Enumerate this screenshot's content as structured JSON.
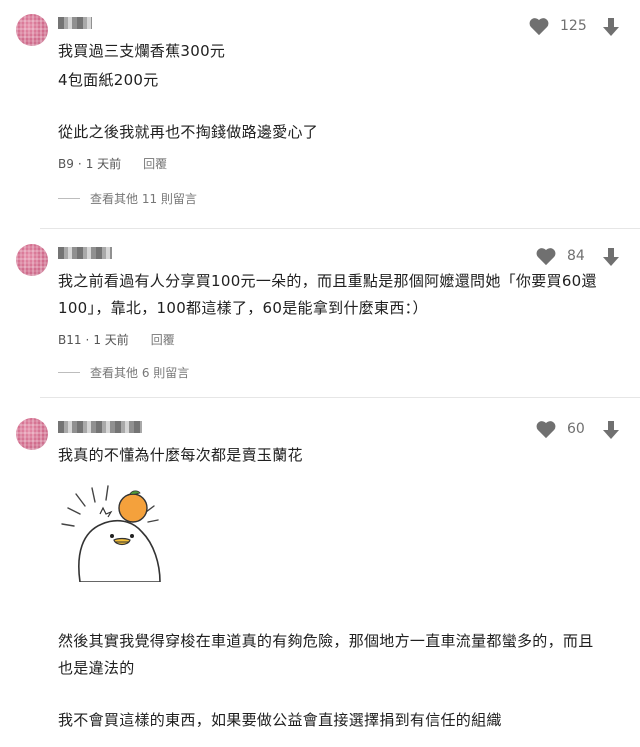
{
  "comments": [
    {
      "likes": "125",
      "lines": [
        "我買過三支爛香蕉300元",
        "4包面紙200元",
        "",
        "從此之後我就再也不掏錢做路邊愛心了"
      ],
      "floor": "B9",
      "time": "1 天前",
      "reply_label": "回覆",
      "view_more": "查看其他 11 則留言"
    },
    {
      "likes": "84",
      "lines": [
        "我之前看過有人分享買100元一朵的，而且重點是那個阿嬤還問她「你要買60還",
        "100」，靠北，100都這樣了，60是能拿到什麼東西：）"
      ],
      "floor": "B11",
      "time": "1 天前",
      "reply_label": "回覆",
      "view_more": "查看其他 6 則留言"
    },
    {
      "likes": "60",
      "lines_top": [
        "我真的不懂為什麼每次都是賣玉蘭花"
      ],
      "lines_bottom": [
        " 然後其實我覺得穿梭在車道真的有夠危險，那個地方一直車流量都蠻多的，而且",
        "也是違法的",
        "",
        "我不會買這樣的東西，如果要做公益會直接選擇捐到有信任的組織"
      ],
      "sticker": "duck-with-orange-sticker"
    }
  ],
  "colors": {
    "icon": "#707070",
    "text": "#202020",
    "meta": "#555555"
  },
  "icons": {
    "like": "heart-icon",
    "dislike": "arrow-down-icon"
  }
}
